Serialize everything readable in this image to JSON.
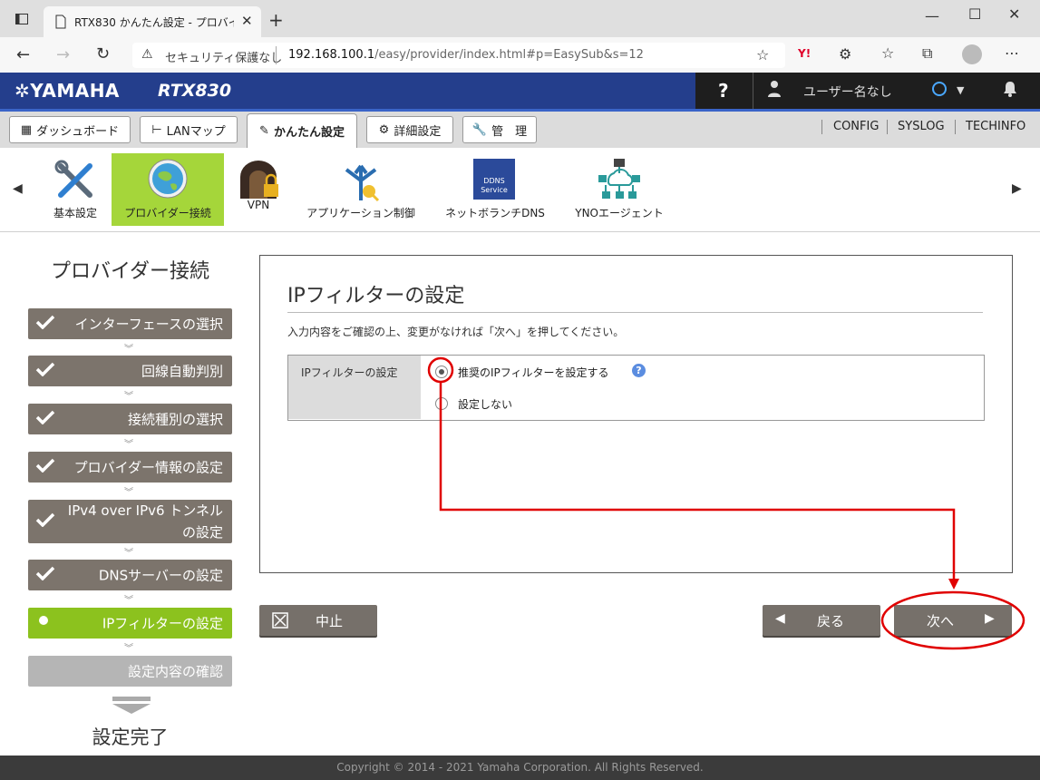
{
  "browser": {
    "tab_title": "RTX830 かんたん設定 - プロバイダー接続",
    "security_label": "セキュリティ保護なし",
    "url_host": "192.168.100.1",
    "url_path": "/easy/provider/index.html#p=EasySub&s=12"
  },
  "header": {
    "brand": "YAMAHA",
    "model": "RTX830",
    "help": "?",
    "user_name": "ユーザー名なし"
  },
  "main_tabs": [
    {
      "label": "ダッシュボード"
    },
    {
      "label": "LANマップ"
    },
    {
      "label": "かんたん設定"
    },
    {
      "label": "詳細設定"
    },
    {
      "label": "管　理"
    }
  ],
  "top_links": [
    "CONFIG",
    "SYSLOG",
    "TECHINFO"
  ],
  "functions": [
    {
      "label": "基本設定"
    },
    {
      "label": "プロバイダー接続"
    },
    {
      "label": "VPN"
    },
    {
      "label": "アプリケーション制御"
    },
    {
      "label": "ネットボランチDNS"
    },
    {
      "label": "YNOエージェント"
    }
  ],
  "ddns_icon_text": [
    "DDNS",
    "Service"
  ],
  "wizard": {
    "title": "プロバイダー接続",
    "steps": [
      {
        "label": "インターフェースの選択"
      },
      {
        "label": "回線自動判別"
      },
      {
        "label": "接続種別の選択"
      },
      {
        "label": "プロバイダー情報の設定"
      },
      {
        "label_line1": "IPv4 over IPv6 トンネル",
        "label_line2": "の設定"
      },
      {
        "label": "DNSサーバーの設定"
      },
      {
        "label": "IPフィルターの設定"
      },
      {
        "label": "設定内容の確認"
      }
    ],
    "done_label": "設定完了"
  },
  "content": {
    "heading": "IPフィルターの設定",
    "instruction": "入力内容をご確認の上、変更がなければ「次へ」を押してください。",
    "row_label": "IPフィルターの設定",
    "options": [
      {
        "label": "推奨のIPフィルターを設定する",
        "selected": true
      },
      {
        "label": "設定しない",
        "selected": false
      }
    ]
  },
  "buttons": {
    "cancel": "中止",
    "back": "戻る",
    "next": "次へ"
  },
  "footer": "Copyright © 2014 - 2021 Yamaha Corporation. All Rights Reserved.",
  "colors": {
    "header_blue": "#243e8c",
    "active_green": "#8cc21e",
    "step_gray": "#7c746c",
    "annotation_red": "#e00000"
  }
}
